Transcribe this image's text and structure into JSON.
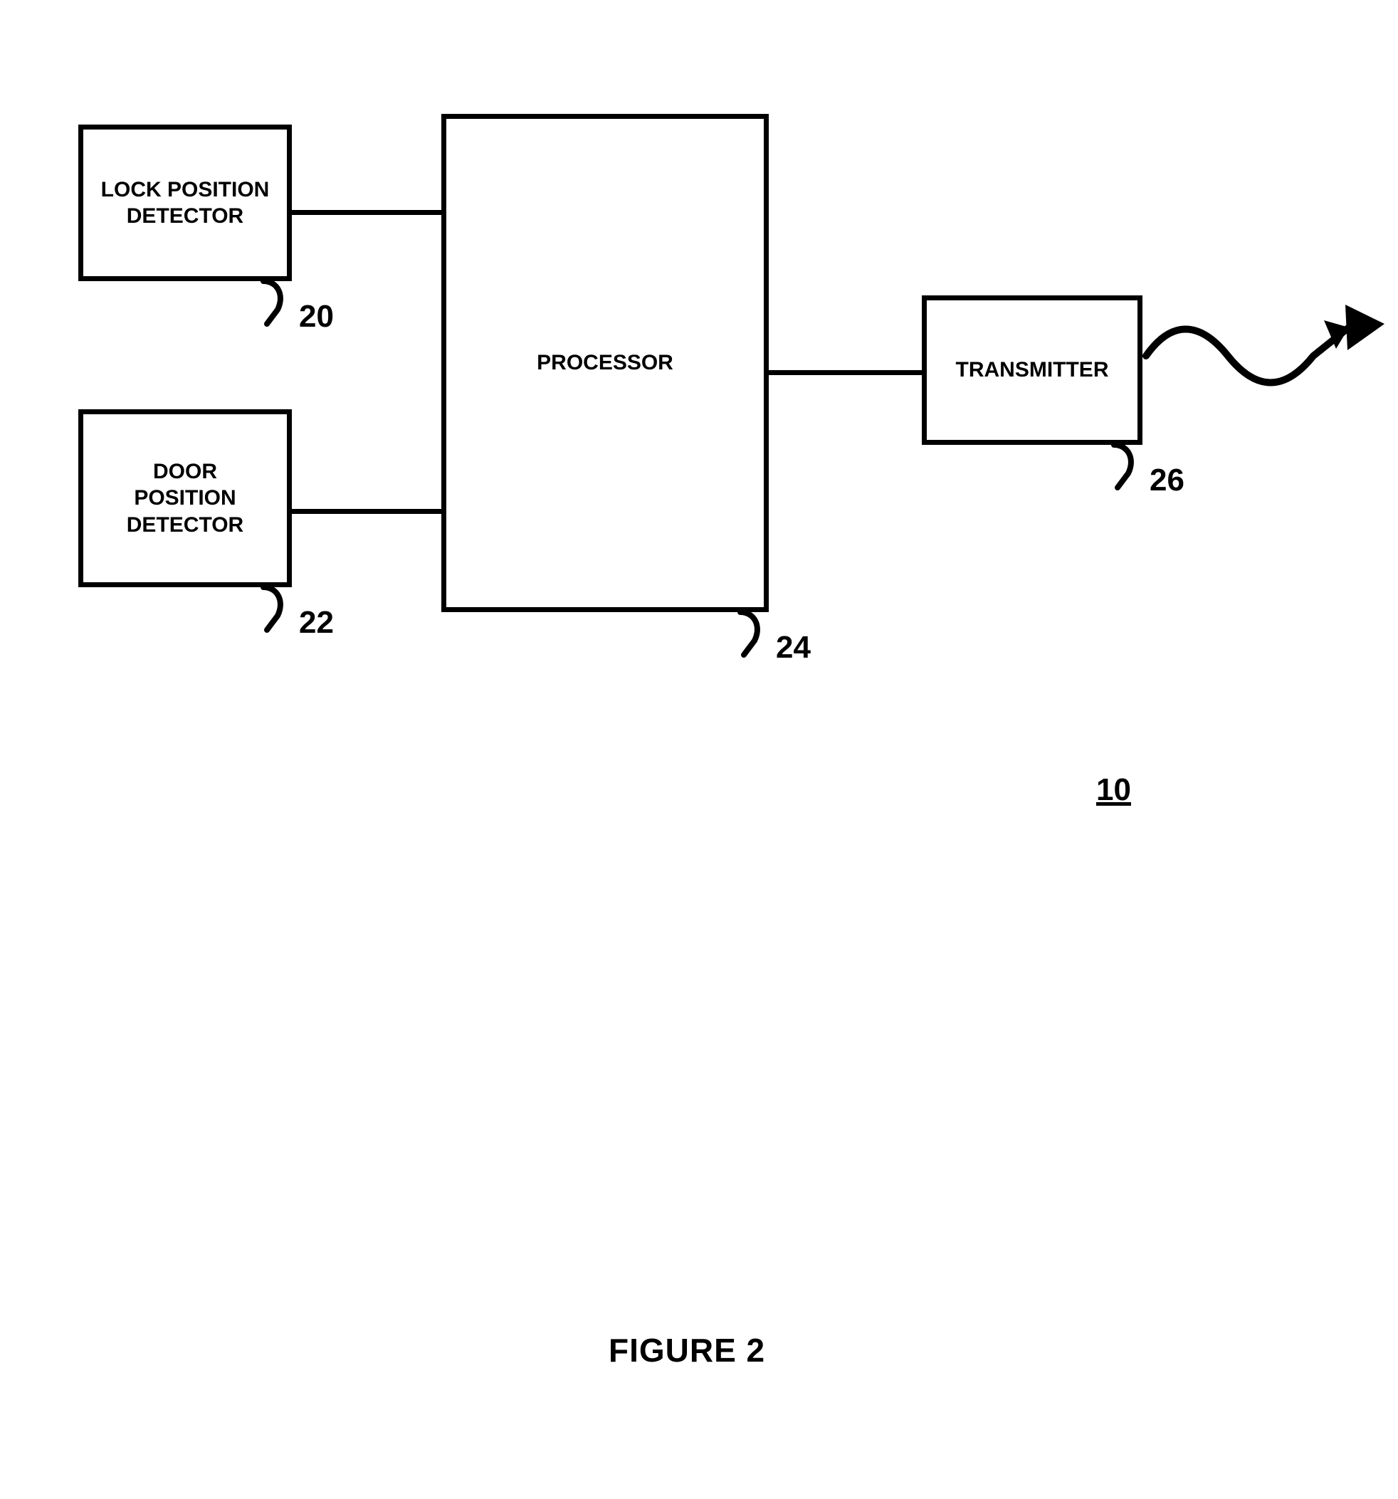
{
  "blocks": {
    "lock_detector": {
      "label": "LOCK POSITION\nDETECTOR",
      "ref": "20"
    },
    "door_detector": {
      "label": "DOOR\nPOSITION\nDETECTOR",
      "ref": "22"
    },
    "processor": {
      "label": "PROCESSOR",
      "ref": "24"
    },
    "transmitter": {
      "label": "TRANSMITTER",
      "ref": "26"
    }
  },
  "figure": {
    "ref": "10",
    "title": "FIGURE 2"
  }
}
